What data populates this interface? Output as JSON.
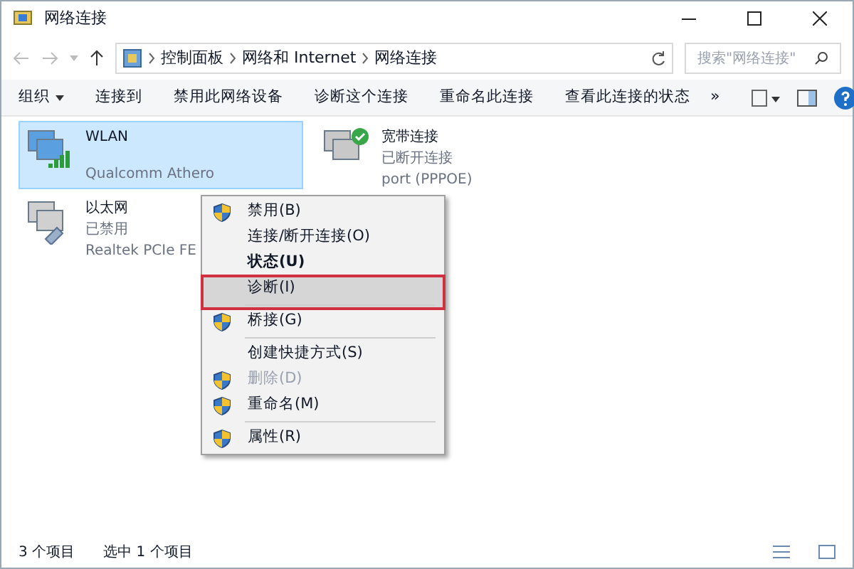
{
  "window": {
    "title": "网络连接"
  },
  "address_bar": {
    "segments": [
      "控制面板",
      "网络和 Internet",
      "网络连接"
    ],
    "search_placeholder": "搜索\"网络连接\""
  },
  "toolbar": {
    "items": [
      {
        "label": "组织",
        "dropdown": true
      },
      {
        "label": "连接到",
        "dropdown": false
      },
      {
        "label": "禁用此网络设备",
        "dropdown": false
      },
      {
        "label": "诊断这个连接",
        "dropdown": false
      },
      {
        "label": "重命名此连接",
        "dropdown": false
      },
      {
        "label": "查看此连接的状态",
        "dropdown": false
      }
    ],
    "overflow": "»"
  },
  "connections": [
    {
      "name": "WLAN",
      "device": "Qualcomm Athero",
      "kind": "wifi",
      "selected": true
    },
    {
      "name": "宽带连接",
      "status": "已断开连接",
      "device": "port (PPPOE)",
      "kind": "broadband",
      "selected": false
    },
    {
      "name": "以太网",
      "status": "已禁用",
      "device": "Realtek PCIe FE",
      "kind": "ethernet",
      "selected": false
    }
  ],
  "context_menu": [
    {
      "label": "禁用(B)",
      "shield": true,
      "bold": false,
      "disabled": false,
      "selected": false,
      "separator_after": false
    },
    {
      "label": "连接/断开连接(O)",
      "shield": false,
      "bold": false,
      "disabled": false,
      "selected": false,
      "separator_after": false
    },
    {
      "label": "状态(U)",
      "shield": false,
      "bold": true,
      "disabled": false,
      "selected": false,
      "separator_after": false
    },
    {
      "label": "诊断(I)",
      "shield": false,
      "bold": false,
      "disabled": false,
      "selected": true,
      "separator_after": true
    },
    {
      "label": "桥接(G)",
      "shield": true,
      "bold": false,
      "disabled": false,
      "selected": false,
      "separator_after": true
    },
    {
      "label": "创建快捷方式(S)",
      "shield": false,
      "bold": false,
      "disabled": false,
      "selected": false,
      "separator_after": false
    },
    {
      "label": "删除(D)",
      "shield": true,
      "bold": false,
      "disabled": true,
      "selected": false,
      "separator_after": false
    },
    {
      "label": "重命名(M)",
      "shield": true,
      "bold": false,
      "disabled": false,
      "selected": false,
      "separator_after": true
    },
    {
      "label": "属性(R)",
      "shield": true,
      "bold": false,
      "disabled": false,
      "selected": false,
      "separator_after": false
    }
  ],
  "status_bar": {
    "count": "3 个项目",
    "selection": "选中 1 个项目"
  }
}
